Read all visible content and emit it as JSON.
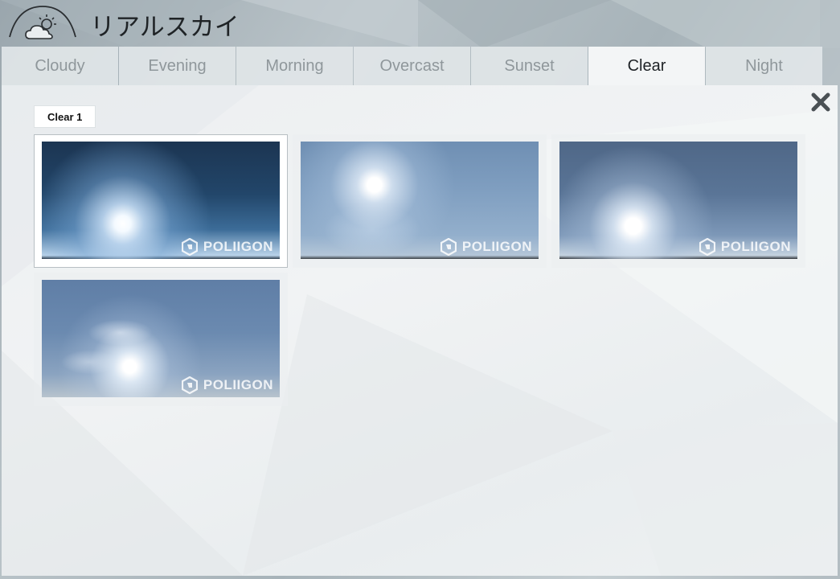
{
  "app": {
    "title": "リアルスカイ",
    "logo_icon": "cloud-sun-icon"
  },
  "tabs": [
    {
      "label": "Cloudy",
      "active": false
    },
    {
      "label": "Evening",
      "active": false
    },
    {
      "label": "Morning",
      "active": false
    },
    {
      "label": "Overcast",
      "active": false
    },
    {
      "label": "Sunset",
      "active": false
    },
    {
      "label": "Clear",
      "active": true
    },
    {
      "label": "Night",
      "active": false
    }
  ],
  "panel": {
    "close_icon": "close-icon",
    "group_label": "Clear 1",
    "thumbnails": [
      {
        "watermark": "POLIIGON",
        "selected": true
      },
      {
        "watermark": "POLIIGON",
        "selected": false
      },
      {
        "watermark": "POLIIGON",
        "selected": false
      },
      {
        "watermark": "POLIIGON",
        "selected": false
      }
    ]
  },
  "colors": {
    "active_tab_text": "#1e2226",
    "inactive_tab_text": "#8f979b",
    "panel_background": "#eef1f2"
  }
}
